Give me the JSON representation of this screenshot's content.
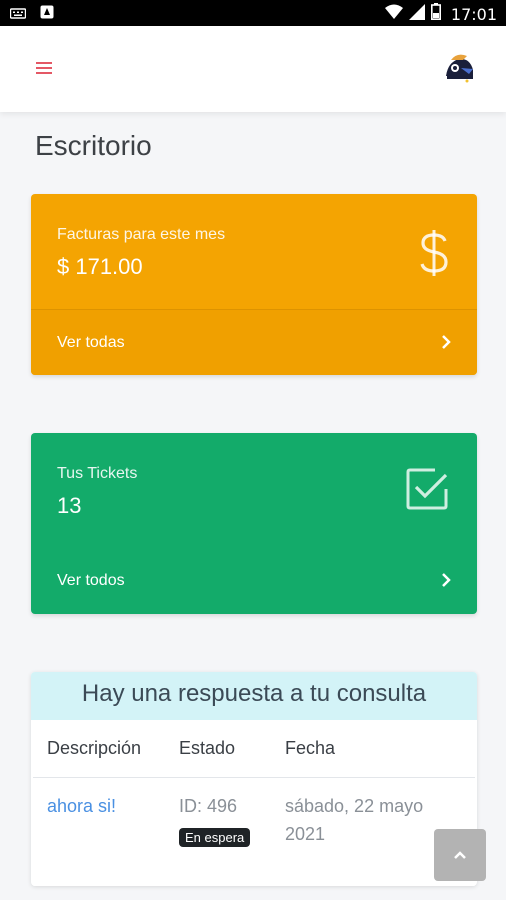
{
  "status_bar": {
    "time": "17:01",
    "icons": [
      "keyboard-icon",
      "notification-icon",
      "wifi-icon",
      "signal-icon",
      "battery-icon"
    ]
  },
  "header": {
    "menu_icon": "hamburger-menu-icon",
    "menu_color": "#e45865"
  },
  "page": {
    "title": "Escritorio"
  },
  "cards": {
    "invoices": {
      "label": "Facturas para este mes",
      "value": "$ 171.00",
      "icon": "dollar-icon",
      "footer_label": "Ver todas",
      "color": "#f4a402"
    },
    "tickets": {
      "label": "Tus Tickets",
      "value": "13",
      "icon": "checkbox-icon",
      "footer_label": "Ver todos",
      "color": "#13ab6a"
    }
  },
  "notice": {
    "title": "Hay una respuesta a tu consulta",
    "columns": [
      "Descripción",
      "Estado",
      "Fecha"
    ],
    "rows": [
      {
        "description": "ahora si!",
        "id": "ID: 496",
        "status": "En espera",
        "date_line1": "sábado, 22 mayo",
        "date_line2": "2021"
      }
    ]
  },
  "scroll_top": {
    "icon": "chevron-up-icon"
  }
}
